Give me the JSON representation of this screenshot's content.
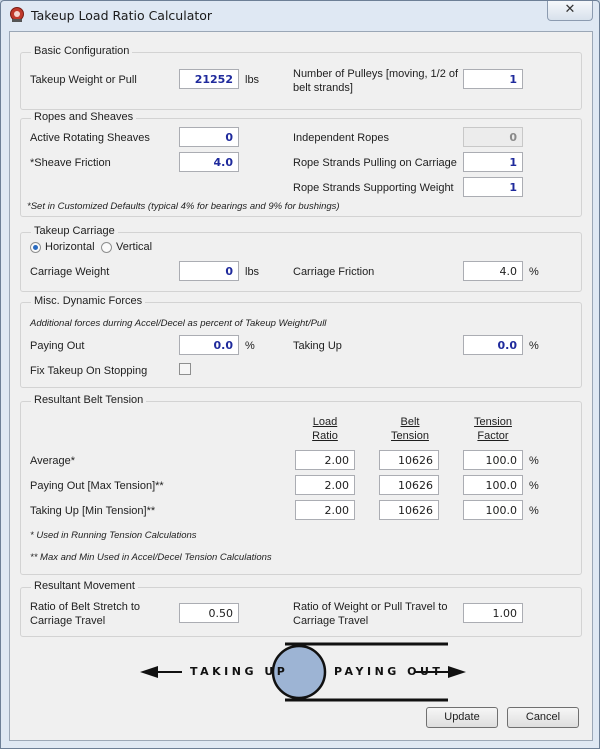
{
  "window": {
    "title": "Takeup Load Ratio Calculator",
    "close_glyph": "✕"
  },
  "basic": {
    "title": "Basic Configuration",
    "takeup_weight_label": "Takeup Weight or Pull",
    "takeup_weight_value": "21252",
    "takeup_weight_unit": "lbs",
    "pulleys_label": "Number of Pulleys [moving, 1/2 of belt strands]",
    "pulleys_value": "1"
  },
  "ropes": {
    "title": "Ropes and Sheaves",
    "active_sheaves_label": "Active Rotating Sheaves",
    "active_sheaves_value": "0",
    "sheave_friction_label": "*Sheave Friction",
    "sheave_friction_value": "4.0",
    "independent_ropes_label": "Independent Ropes",
    "independent_ropes_value": "0",
    "strands_pulling_label": "Rope Strands Pulling on Carriage",
    "strands_pulling_value": "1",
    "strands_supporting_label": "Rope Strands Supporting Weight",
    "strands_supporting_value": "1",
    "note": "*Set in Customized Defaults (typical 4% for bearings and 9% for bushings)"
  },
  "carriage": {
    "title": "Takeup Carriage",
    "horizontal_label": "Horizontal",
    "vertical_label": "Vertical",
    "selected": "horizontal",
    "weight_label": "Carriage Weight",
    "weight_value": "0",
    "weight_unit": "lbs",
    "friction_label": "Carriage Friction",
    "friction_value": "4.0",
    "friction_unit": "%"
  },
  "dynamic": {
    "title": "Misc. Dynamic Forces",
    "note": "Additional forces durring Accel/Decel as percent of Takeup Weight/Pull",
    "paying_out_label": "Paying Out",
    "paying_out_value": "0.0",
    "paying_out_unit": "%",
    "taking_up_label": "Taking Up",
    "taking_up_value": "0.0",
    "taking_up_unit": "%",
    "fix_label": "Fix Takeup On Stopping",
    "fix_checked": false
  },
  "tension": {
    "title": "Resultant Belt Tension",
    "col_load": "Load Ratio",
    "col_belt": "Belt Tension",
    "col_factor": "Tension Factor",
    "rows": [
      {
        "label": "Average*",
        "load": "2.00",
        "belt": "10626",
        "factor": "100.0",
        "unit": "%"
      },
      {
        "label": "Paying Out [Max Tension]**",
        "load": "2.00",
        "belt": "10626",
        "factor": "100.0",
        "unit": "%"
      },
      {
        "label": "Taking Up [Min Tension]**",
        "load": "2.00",
        "belt": "10626",
        "factor": "100.0",
        "unit": "%"
      }
    ],
    "note1": "* Used in Running Tension Calculations",
    "note2": "** Max and Min Used in Accel/Decel Tension Calculations"
  },
  "movement": {
    "title": "Resultant Movement",
    "stretch_label": "Ratio of Belt Stretch to Carriage Travel",
    "stretch_value": "0.50",
    "travel_label": "Ratio of Weight or Pull Travel to Carriage Travel",
    "travel_value": "1.00"
  },
  "diagram": {
    "taking_up": "TAKING UP",
    "paying_out": "PAYING OUT",
    "pulley_color": "#9db4d4"
  },
  "buttons": {
    "update": "Update",
    "cancel": "Cancel"
  }
}
